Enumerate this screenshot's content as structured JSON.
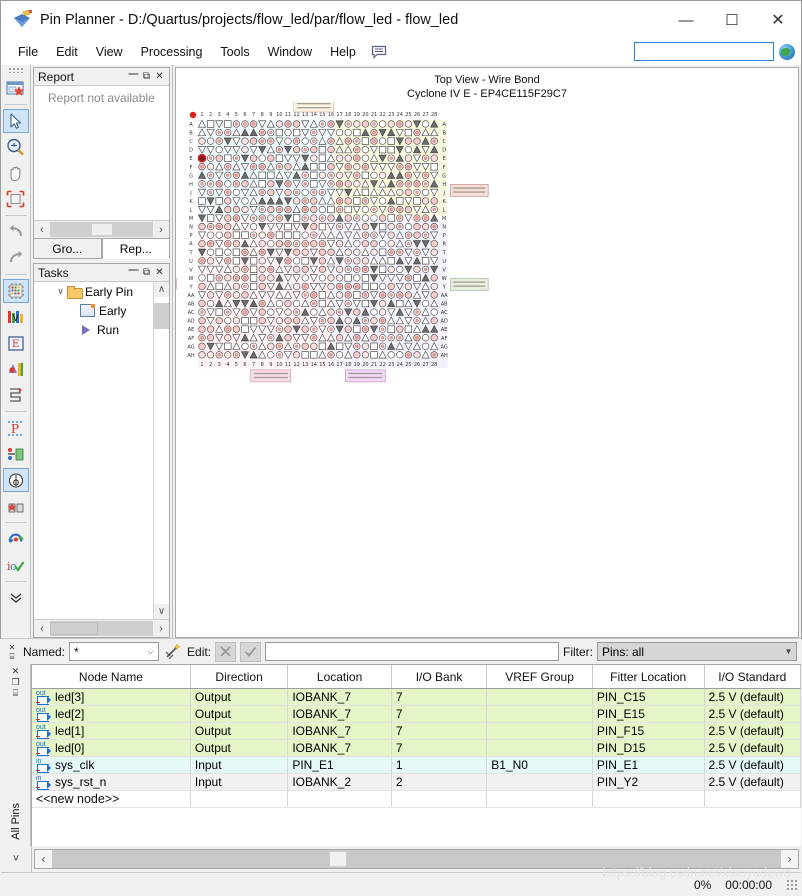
{
  "window": {
    "title": "Pin Planner - D:/Quartus/projects/flow_led/par/flow_led - flow_led",
    "icon": "pin-planner-icon",
    "minimize": "—",
    "maximize": "☐",
    "close": "✕"
  },
  "menu": {
    "items": [
      "File",
      "Edit",
      "View",
      "Processing",
      "Tools",
      "Window",
      "Help"
    ],
    "note_icon": "message-note-icon",
    "search_value": "",
    "search_placeholder": "",
    "globe_icon": "globe-icon"
  },
  "left_toolbar": {
    "icons": [
      {
        "name": "new-report-icon",
        "selected": false
      },
      {
        "name": "select-arrow-icon",
        "selected": true
      },
      {
        "name": "zoom-icon",
        "selected": false
      },
      {
        "name": "pan-hand-icon",
        "selected": false
      },
      {
        "name": "fit-in-window-icon",
        "selected": false
      },
      {
        "name": "undo-icon",
        "selected": false
      },
      {
        "name": "redo-icon",
        "selected": false
      },
      {
        "name": "package-view-icon",
        "selected": true
      },
      {
        "name": "pad-view-icon",
        "selected": false
      },
      {
        "name": "interior-cells-icon",
        "selected": false
      },
      {
        "name": "io-banks-icon",
        "selected": false
      },
      {
        "name": "edge-view-icon",
        "selected": false
      },
      {
        "name": "pin-legend-icon",
        "selected": false
      },
      {
        "name": "dual-purpose-pins-icon",
        "selected": false
      },
      {
        "name": "show-io-icon",
        "selected": true
      },
      {
        "name": "highlight-pins-icon",
        "selected": false
      },
      {
        "name": "refresh-icon",
        "selected": false
      },
      {
        "name": "validate-icon",
        "selected": false
      },
      {
        "name": "more-chevrons-icon",
        "selected": false
      }
    ]
  },
  "report_panel": {
    "title": "Report",
    "pin_icon": "pin-panel-icon",
    "float_icon": "float-panel-icon",
    "close_icon": "close-panel-icon",
    "message": "Report not available",
    "scroll_left": "‹",
    "scroll_right": "›"
  },
  "dock_tabs": [
    {
      "label": "Gro...",
      "active": false
    },
    {
      "label": "Rep...",
      "active": true
    }
  ],
  "tasks_panel": {
    "title": "Tasks",
    "pin_icon": "pin-panel-icon",
    "float_icon": "float-panel-icon",
    "close_icon": "close-panel-icon",
    "scroll_left": "‹",
    "scroll_right": "›",
    "scroll_up": "∧",
    "scroll_down": "∨",
    "items": [
      {
        "label": "Early Pin",
        "icon": "folder-icon",
        "caret": "∨",
        "indent": 0
      },
      {
        "label": "Early",
        "icon": "report-doc-icon",
        "caret": "",
        "indent": 1
      },
      {
        "label": "Run",
        "icon": "run-play-icon",
        "caret": "",
        "indent": 1
      }
    ]
  },
  "chip_view": {
    "title_line1": "Top View - Wire Bond",
    "title_line2": "Cyclone IV E - EP4CE115F29C7",
    "columns": [
      "1",
      "2",
      "3",
      "4",
      "5",
      "6",
      "7",
      "8",
      "9",
      "10",
      "11",
      "12",
      "13",
      "14",
      "15",
      "16",
      "17",
      "18",
      "19",
      "20",
      "21",
      "22",
      "23",
      "24",
      "25",
      "26",
      "27",
      "28"
    ],
    "rows": [
      "A",
      "B",
      "C",
      "D",
      "E",
      "F",
      "G",
      "H",
      "J",
      "K",
      "L",
      "M",
      "N",
      "P",
      "R",
      "T",
      "U",
      "V",
      "W",
      "Y",
      "AA",
      "AB",
      "AC",
      "AD",
      "AE",
      "AF",
      "AG",
      "AH"
    ],
    "origin_marker": "red-dot-origin-marker"
  },
  "filter_bar": {
    "close_icon": "✕",
    "pin_icon": "⌸",
    "named_label": "Named:",
    "named_value": "*",
    "named_arrow": "⌵",
    "wand_icon": "wand-icon",
    "edit_label": "Edit:",
    "cancel_icon": "✕",
    "accept_icon": "✓",
    "edit_value": "",
    "filter_label": "Filter:",
    "filter_value": "Pins: all",
    "filter_arrow": "▼"
  },
  "all_pins_strip": {
    "close_icon": "✕",
    "float_icon": "❐",
    "pin_icon": "⌸",
    "tab_label": "All Pins"
  },
  "pin_table": {
    "columns": [
      "Node Name",
      "Direction",
      "Location",
      "I/O Bank",
      "VREF Group",
      "Fitter Location",
      "I/O Standard"
    ],
    "rows": [
      {
        "icon": "output-pin-icon",
        "kind": "out",
        "node": "led[3]",
        "direction": "Output",
        "location": "IOBANK_7",
        "bank": "7",
        "vref": "",
        "fitter": "PIN_C15",
        "standard": "2.5 V (default)"
      },
      {
        "icon": "output-pin-icon",
        "kind": "out",
        "node": "led[2]",
        "direction": "Output",
        "location": "IOBANK_7",
        "bank": "7",
        "vref": "",
        "fitter": "PIN_E15",
        "standard": "2.5 V (default)"
      },
      {
        "icon": "output-pin-icon",
        "kind": "out",
        "node": "led[1]",
        "direction": "Output",
        "location": "IOBANK_7",
        "bank": "7",
        "vref": "",
        "fitter": "PIN_F15",
        "standard": "2.5 V (default)"
      },
      {
        "icon": "output-pin-icon",
        "kind": "out",
        "node": "led[0]",
        "direction": "Output",
        "location": "IOBANK_7",
        "bank": "7",
        "vref": "",
        "fitter": "PIN_D15",
        "standard": "2.5 V (default)"
      },
      {
        "icon": "input-pin-icon",
        "kind": "in1",
        "node": "sys_clk",
        "direction": "Input",
        "location": "PIN_E1",
        "bank": "1",
        "vref": "B1_N0",
        "fitter": "PIN_E1",
        "standard": "2.5 V (default)"
      },
      {
        "icon": "input-pin-icon",
        "kind": "in2",
        "node": "sys_rst_n",
        "direction": "Input",
        "location": "IOBANK_2",
        "bank": "2",
        "vref": "",
        "fitter": "PIN_Y2",
        "standard": "2.5 V (default)"
      }
    ],
    "new_node_label": "<<new node>>"
  },
  "bottom_scroll": {
    "left_arrow": "‹",
    "right_arrow": "›",
    "collapse_icon": "˅"
  },
  "status_bar": {
    "progress": "0%",
    "elapsed": "00:00:00",
    "resize_grip": "resize-grip-icon",
    "watermark": "https://blog.csdn.net/xiaoyudewo"
  },
  "colors": {
    "output_row": "#e6f5c8",
    "input_row": "#e4f8f8",
    "selected_tool": "#cfe4f7",
    "accent_blue": "#2a7fd4"
  }
}
